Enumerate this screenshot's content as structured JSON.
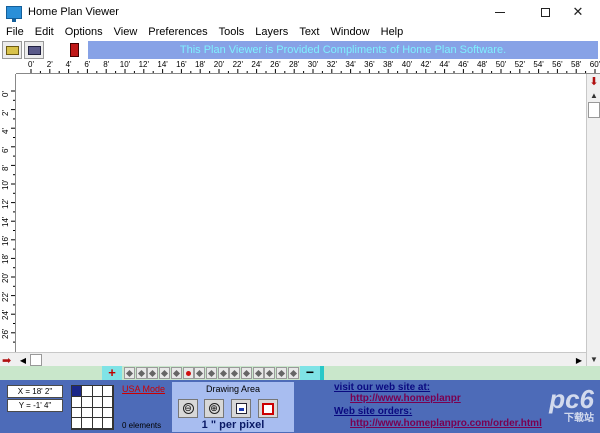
{
  "window": {
    "title": "Home Plan Viewer",
    "minimize_glyph": "—",
    "maximize_glyph": "☐",
    "close_glyph": "✕"
  },
  "menu": [
    "File",
    "Edit",
    "Options",
    "View",
    "Preferences",
    "Tools",
    "Layers",
    "Text",
    "Window",
    "Help"
  ],
  "toolbar": {
    "banner": "This Plan Viewer is Provided Compliments of Home Plan Software.",
    "icons": [
      "open-folder-icon",
      "print-icon",
      "exit-door-icon"
    ]
  },
  "rulers": {
    "top": [
      "0'",
      "2'",
      "4'",
      "6'",
      "8'",
      "10'",
      "12'",
      "14'",
      "16'",
      "18'",
      "20'",
      "22'",
      "24'",
      "26'",
      "28'",
      "30'",
      "32'",
      "34'",
      "36'",
      "38'",
      "40'",
      "42'",
      "44'",
      "46'",
      "48'",
      "50'",
      "52'",
      "54'",
      "56'",
      "58'",
      "60'"
    ],
    "left": [
      "0'",
      "2'",
      "4'",
      "6'",
      "8'",
      "10'",
      "12'",
      "14'",
      "16'",
      "18'",
      "20'",
      "22'",
      "24'",
      "26'"
    ]
  },
  "layers": {
    "add_label": "+",
    "remove_label": "−",
    "count": 15,
    "active_index": 5
  },
  "status": {
    "x_coord": "X = 18' 2\"",
    "y_coord": "Y = -1' 4\"",
    "mode": "USA Mode",
    "elements": "0 elements",
    "drawing_area_title": "Drawing Area",
    "scale": "1 \" per pixel",
    "zoom_out_glyph": "⊖",
    "zoom_in_glyph": "⊕",
    "visit_heading": "visit our web site at:",
    "visit_url": "http://www.homeplanpr",
    "orders_heading": "Web site orders:",
    "orders_url": "http://www.homeplanpro.com/order.html",
    "watermark": "pc6",
    "watermark_sub": "下载站"
  },
  "colors": {
    "banner_bg": "#87a2e6",
    "banner_text": "#7ff0ff",
    "status_bg": "#4d6bb8",
    "layer_bar_bg": "#c9e7cb",
    "link_color": "#7a0050",
    "mode_color": "#cc0000"
  }
}
